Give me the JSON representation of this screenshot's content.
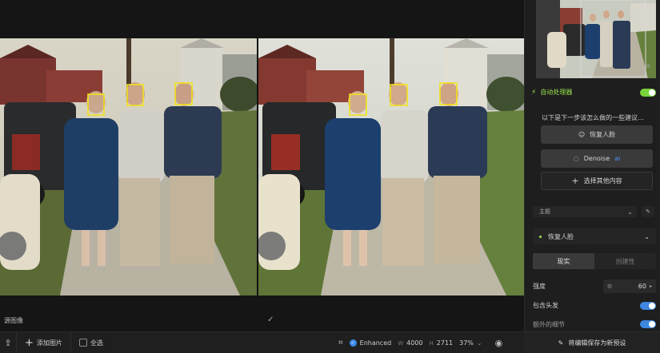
{
  "canvas": {
    "source_label": "源图像"
  },
  "bottombar": {
    "add_image": "添加图片",
    "select_all": "全选",
    "enhanced": "Enhanced",
    "width_label": "W",
    "width": "4000",
    "height_label": "H",
    "height": "2711",
    "zoom": "37%",
    "save_preset": "将编辑保存为新预设"
  },
  "panel": {
    "auto_processor": "自动处理器",
    "suggestion_text": "以下是下一步该怎么做的一些建议...",
    "suggestions": {
      "face": "恢复人脸",
      "denoise": "Denoise",
      "ai": "ai",
      "more": "选择其他内容"
    },
    "theme": "主题",
    "face_dropdown": "恢复人脸",
    "tabs": {
      "realistic": "现实",
      "creative": "创建性"
    },
    "strength_label": "强度",
    "strength_value": "60",
    "include_hair": "包含头发",
    "cut_label": "额外的细节"
  },
  "colors": {
    "accent_green": "#9be64d",
    "toggle_blue": "#3d86e0",
    "face_box": "#f2e21a",
    "enhanced_blue": "#3b8be9"
  },
  "icons": {
    "upload": "upload-icon",
    "plus": "plus-icon",
    "face_detect": "face-detect-icon",
    "eye": "eye-icon",
    "bolt": "bolt-icon",
    "crop": "crop-icon",
    "smile": "smile-icon",
    "denoise": "denoise-icon",
    "edit": "edit-icon",
    "check": "check-icon"
  }
}
